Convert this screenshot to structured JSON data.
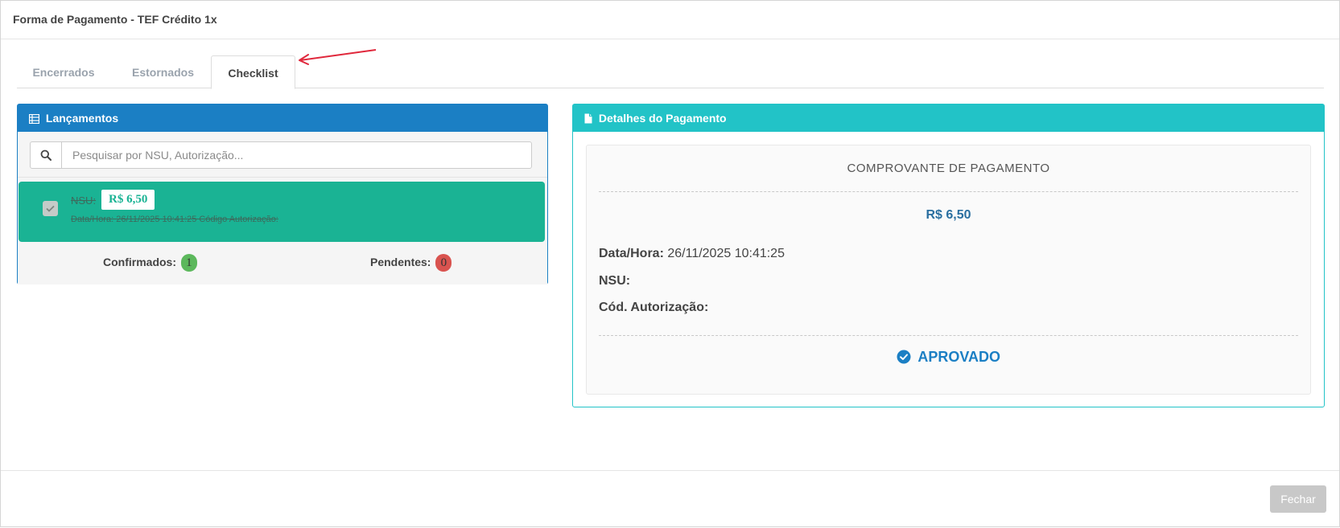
{
  "modal": {
    "title": "Forma de Pagamento - TEF Crédito 1x"
  },
  "tabs": [
    {
      "label": "Encerrados",
      "active": false
    },
    {
      "label": "Estornados",
      "active": false
    },
    {
      "label": "Checklist",
      "active": true
    }
  ],
  "left_panel": {
    "title": "Lançamentos",
    "icon": "list-icon",
    "search": {
      "placeholder": "Pesquisar por NSU, Autorização...",
      "value": ""
    },
    "entries": [
      {
        "nsu_label": "NSU:",
        "value": "R$ 6,50",
        "details": "Data/Hora: 26/11/2025 10:41:25 Código Autorização:",
        "checked": true
      }
    ],
    "confirmed_label": "Confirmados:",
    "confirmed_count": "1",
    "pending_label": "Pendentes:",
    "pending_count": "0"
  },
  "right_panel": {
    "title": "Detalhes do Pagamento",
    "icon": "document-icon",
    "receipt_title": "COMPROVANTE DE PAGAMENTO",
    "amount": "R$ 6,50",
    "datetime_label": "Data/Hora:",
    "datetime_value": "26/11/2025 10:41:25",
    "nsu_label": "NSU:",
    "nsu_value": "",
    "auth_label": "Cód. Autorização:",
    "auth_value": "",
    "status": "APROVADO"
  },
  "footer": {
    "close_label": "Fechar"
  },
  "colors": {
    "primary_blue": "#1b7fc4",
    "teal": "#22c3c7",
    "entry_green": "#1ab394",
    "badge_green": "#5cb85c",
    "badge_red": "#d9534f",
    "arrow_red": "#e0283c"
  }
}
